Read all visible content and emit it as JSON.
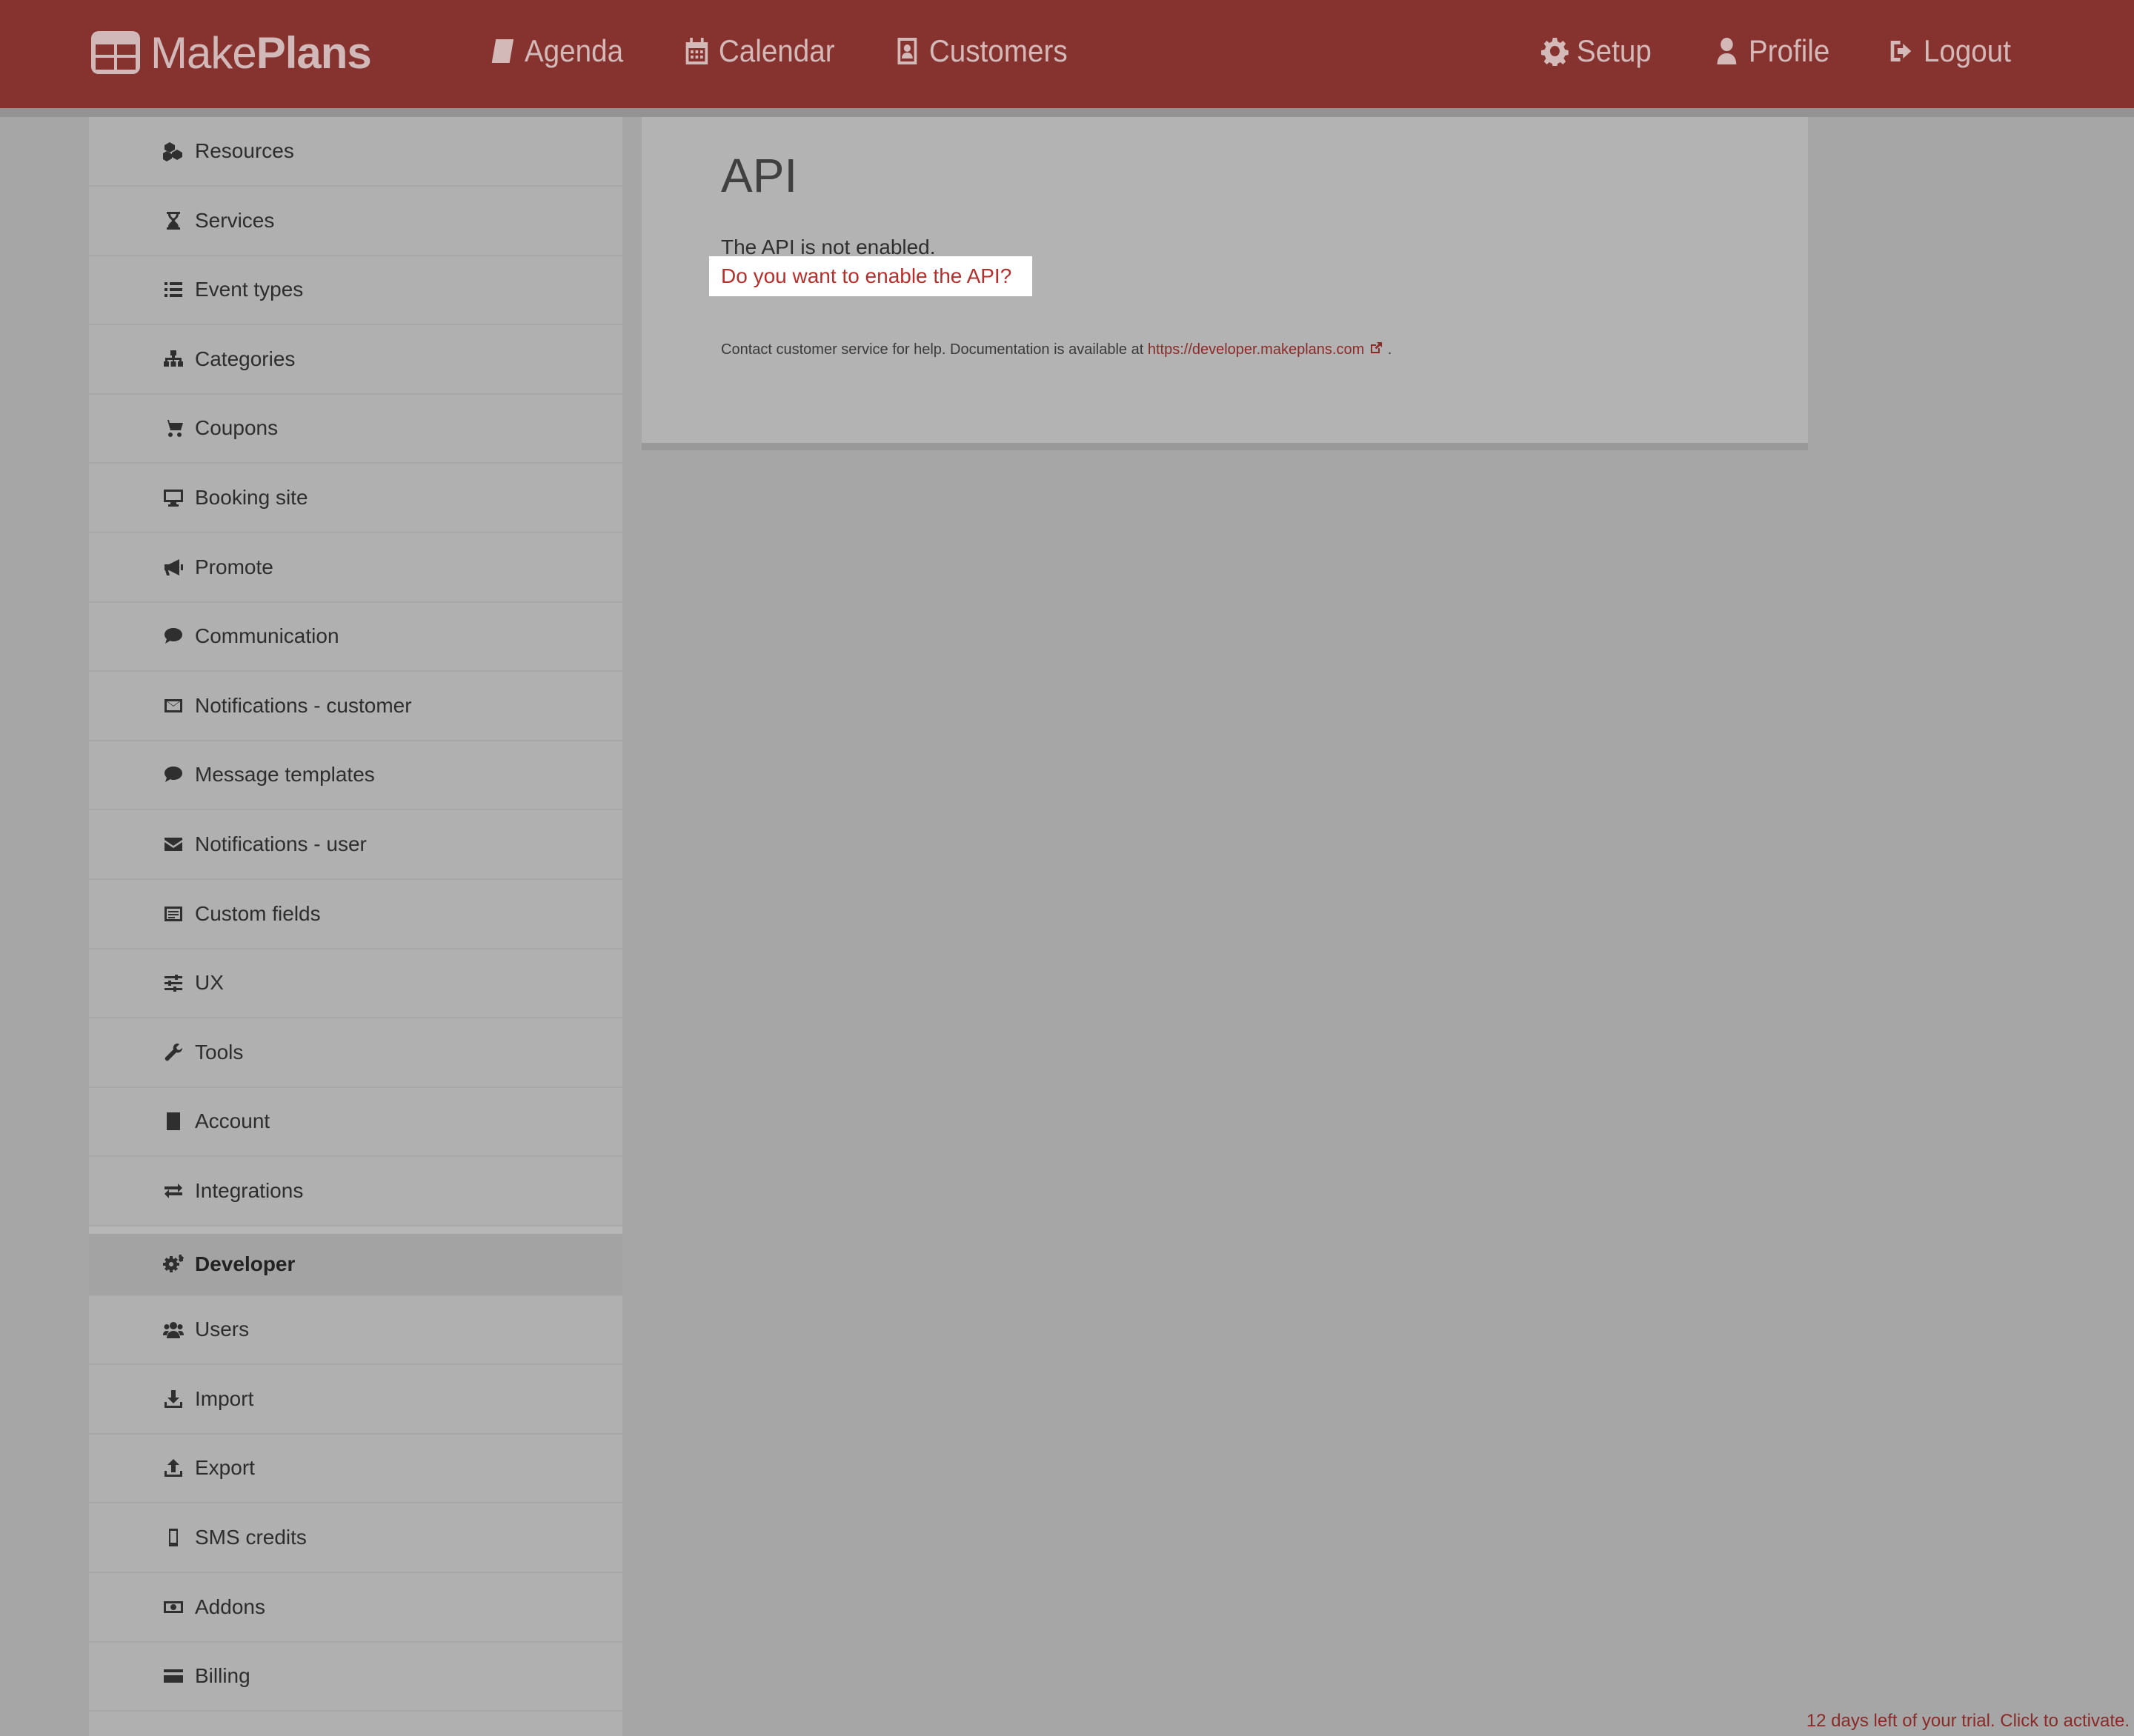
{
  "brand": {
    "name_light": "Make",
    "name_bold": "Plans"
  },
  "nav": {
    "agenda": "Agenda",
    "calendar": "Calendar",
    "customers": "Customers",
    "setup": "Setup",
    "profile": "Profile",
    "logout": "Logout"
  },
  "sidebar": {
    "items": [
      {
        "label": "Resources",
        "icon": "cubes-icon"
      },
      {
        "label": "Services",
        "icon": "hourglass-icon"
      },
      {
        "label": "Event types",
        "icon": "list-icon"
      },
      {
        "label": "Categories",
        "icon": "sitemap-icon"
      },
      {
        "label": "Coupons",
        "icon": "cart-icon"
      },
      {
        "label": "Booking site",
        "icon": "monitor-icon"
      },
      {
        "label": "Promote",
        "icon": "megaphone-icon"
      },
      {
        "label": "Communication",
        "icon": "chat-icon"
      },
      {
        "label": "Notifications - customer",
        "icon": "envelope-outline-icon"
      },
      {
        "label": "Message templates",
        "icon": "chat-icon"
      },
      {
        "label": "Notifications - user",
        "icon": "envelope-icon"
      },
      {
        "label": "Custom fields",
        "icon": "form-icon"
      },
      {
        "label": "UX",
        "icon": "sliders-icon"
      },
      {
        "label": "Tools",
        "icon": "wrench-icon"
      },
      {
        "label": "Account",
        "icon": "building-icon"
      },
      {
        "label": "Integrations",
        "icon": "exchange-icon"
      },
      {
        "label": "Developer",
        "icon": "gears-icon",
        "active": true
      },
      {
        "label": "Users",
        "icon": "users-icon"
      },
      {
        "label": "Import",
        "icon": "download-icon"
      },
      {
        "label": "Export",
        "icon": "upload-icon"
      },
      {
        "label": "SMS credits",
        "icon": "mobile-icon"
      },
      {
        "label": "Addons",
        "icon": "money-icon"
      },
      {
        "label": "Billing",
        "icon": "credit-card-icon"
      }
    ]
  },
  "main": {
    "title": "API",
    "not_enabled": "The API is not enabled.",
    "enable_link": "Do you want to enable the API?",
    "help_prefix": "Contact customer service for help. Documentation is available at",
    "help_link": "https://developer.makeplans.com",
    "help_suffix": "."
  },
  "trial": "12 days left of your trial. Click to activate.",
  "colors": {
    "navbar": "#863330",
    "link": "#b4302d",
    "overlay_gray": "#a6a6a6"
  }
}
